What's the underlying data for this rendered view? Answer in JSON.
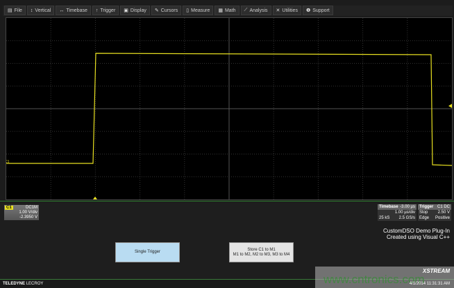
{
  "menu": [
    {
      "icon": "file-icon",
      "glyph": "▤",
      "label": "File"
    },
    {
      "icon": "vertical-icon",
      "glyph": "↕",
      "label": "Vertical"
    },
    {
      "icon": "timebase-icon",
      "glyph": "↔",
      "label": "Timebase"
    },
    {
      "icon": "trigger-icon",
      "glyph": "↑",
      "label": "Trigger"
    },
    {
      "icon": "display-icon",
      "glyph": "▣",
      "label": "Display"
    },
    {
      "icon": "cursors-icon",
      "glyph": "✎",
      "label": "Cursors"
    },
    {
      "icon": "measure-icon",
      "glyph": "▯",
      "label": "Measure"
    },
    {
      "icon": "math-icon",
      "glyph": "▦",
      "label": "Math"
    },
    {
      "icon": "analysis-icon",
      "glyph": "⟋",
      "label": "Analysis"
    },
    {
      "icon": "utilities-icon",
      "glyph": "✕",
      "label": "Utilities"
    },
    {
      "icon": "support-icon",
      "glyph": "❶",
      "label": "Support"
    }
  ],
  "trace_color": "#e8e020",
  "channel": {
    "tag": "C1",
    "coupling": "DC1M",
    "vdiv": "1.00 V/div",
    "offset": "-2.3950 V",
    "marker": "C1"
  },
  "timebase": {
    "label": "Timebase",
    "delay": "-3.00 µs",
    "tdiv": "1.00 µs/div",
    "samples": "25 kS",
    "rate": "2.5 GS/s"
  },
  "trigger": {
    "label": "Trigger",
    "source": "C1 DC",
    "mode": "Stop",
    "level": "2.50 V",
    "type": "Edge",
    "slope": "Positive"
  },
  "plugin": {
    "line1": "CustomDSO Demo Plug-In",
    "line2": "Created using Visual C++"
  },
  "buttons": {
    "single": "Single Trigger",
    "store_line1": "Store C1 to M1",
    "store_line2": "M1 to M2, M2 to M3, M3 to M4"
  },
  "footer": {
    "brand_bold": "TELEDYNE",
    "brand": "LECROY",
    "logo": "XSTREAM",
    "datetime": "4/1/2014 11:31:31 AM"
  },
  "watermark": "www.cntronics.com"
}
